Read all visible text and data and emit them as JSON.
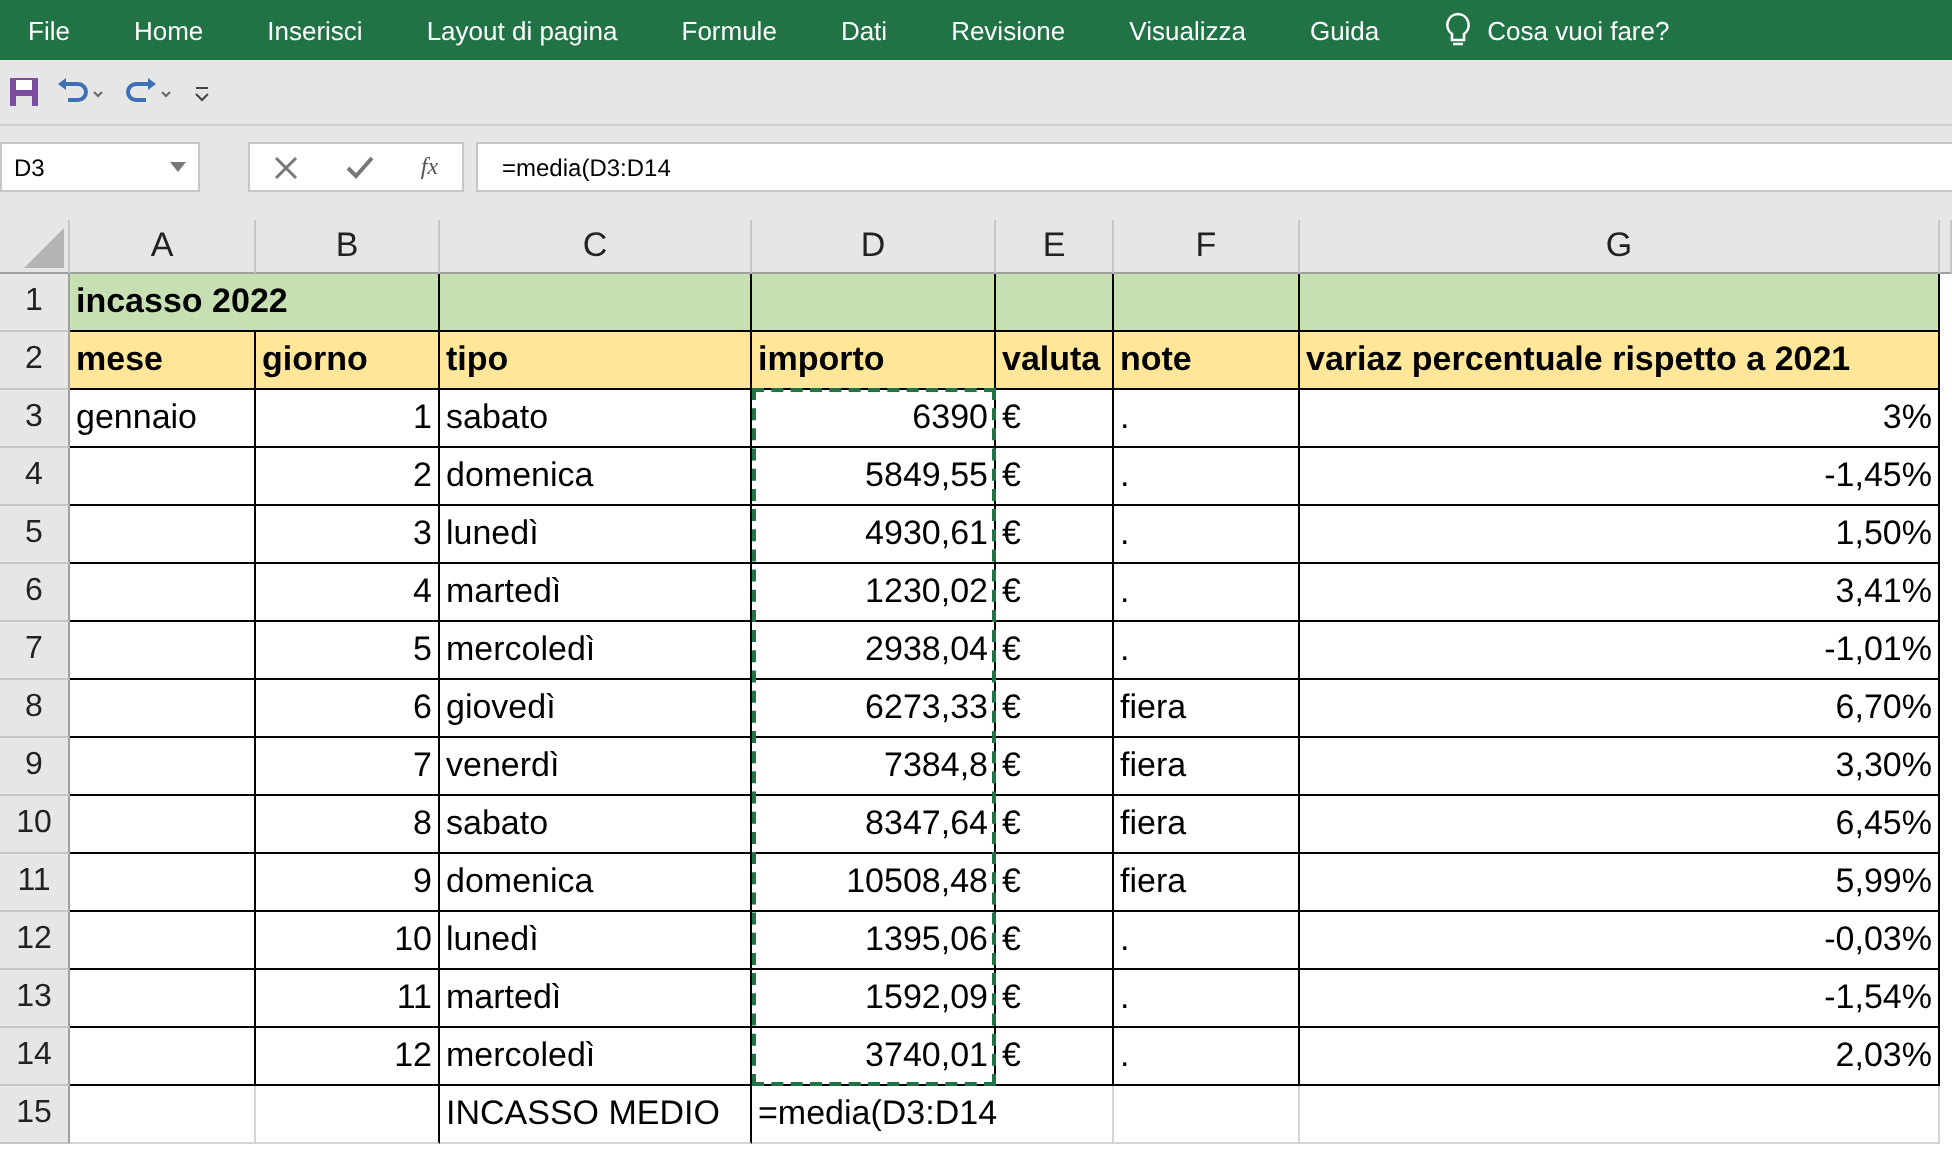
{
  "menu": [
    {
      "label": "File",
      "selected": false
    },
    {
      "label": "Home",
      "selected": false
    },
    {
      "label": "Inserisci",
      "selected": false
    },
    {
      "label": "Layout di pagina",
      "selected": false
    },
    {
      "label": "Formule",
      "selected": false
    },
    {
      "label": "Dati",
      "selected": false
    },
    {
      "label": "Revisione",
      "selected": false
    },
    {
      "label": "Visualizza",
      "selected": false
    },
    {
      "label": "Guida",
      "selected": false
    }
  ],
  "search": {
    "placeholder": "Cosa vuoi fare?"
  },
  "formula_bar": {
    "name_box": "D3",
    "function_button": "fx",
    "value": "=media(D3:D14"
  },
  "columns": [
    "A",
    "B",
    "C",
    "D",
    "E",
    "F",
    "G"
  ],
  "title_row": {
    "row_number": "1",
    "text": "incasso 2022"
  },
  "header_row": {
    "row_number": "2",
    "cells": [
      "mese",
      "giorno",
      "tipo",
      "importo",
      "valuta",
      "note",
      "variaz percentuale rispetto a 2021"
    ]
  },
  "rows": [
    {
      "row_number": "3",
      "cells": [
        "gennaio",
        "1",
        "sabato",
        "6390",
        "€",
        ".",
        "3%"
      ]
    },
    {
      "row_number": "4",
      "cells": [
        "",
        "2",
        "domenica",
        "5849,55",
        "€",
        ".",
        "-1,45%"
      ]
    },
    {
      "row_number": "5",
      "cells": [
        "",
        "3",
        "lunedì",
        "4930,61",
        "€",
        ".",
        "1,50%"
      ]
    },
    {
      "row_number": "6",
      "cells": [
        "",
        "4",
        "martedì",
        "1230,02",
        "€",
        ".",
        "3,41%"
      ]
    },
    {
      "row_number": "7",
      "cells": [
        "",
        "5",
        "mercoledì",
        "2938,04",
        "€",
        ".",
        "-1,01%"
      ]
    },
    {
      "row_number": "8",
      "cells": [
        "",
        "6",
        "giovedì",
        "6273,33",
        "€",
        "fiera",
        "6,70%"
      ]
    },
    {
      "row_number": "9",
      "cells": [
        "",
        "7",
        "venerdì",
        "7384,8",
        "€",
        "fiera",
        "3,30%"
      ]
    },
    {
      "row_number": "10",
      "cells": [
        "",
        "8",
        "sabato",
        "8347,64",
        "€",
        "fiera",
        "6,45%"
      ]
    },
    {
      "row_number": "11",
      "cells": [
        "",
        "9",
        "domenica",
        "10508,48",
        "€",
        "fiera",
        "5,99%"
      ]
    },
    {
      "row_number": "12",
      "cells": [
        "",
        "10",
        "lunedì",
        "1395,06",
        "€",
        ".",
        "-0,03%"
      ]
    },
    {
      "row_number": "13",
      "cells": [
        "",
        "11",
        "martedì",
        "1592,09",
        "€",
        ".",
        "-1,54%"
      ]
    },
    {
      "row_number": "14",
      "cells": [
        "",
        "12",
        "mercoledì",
        "3740,01",
        "€",
        ".",
        "2,03%"
      ]
    }
  ],
  "footer_row": {
    "row_number": "15",
    "label": "INCASSO MEDIO",
    "editing": "=media(D3:D14"
  }
}
